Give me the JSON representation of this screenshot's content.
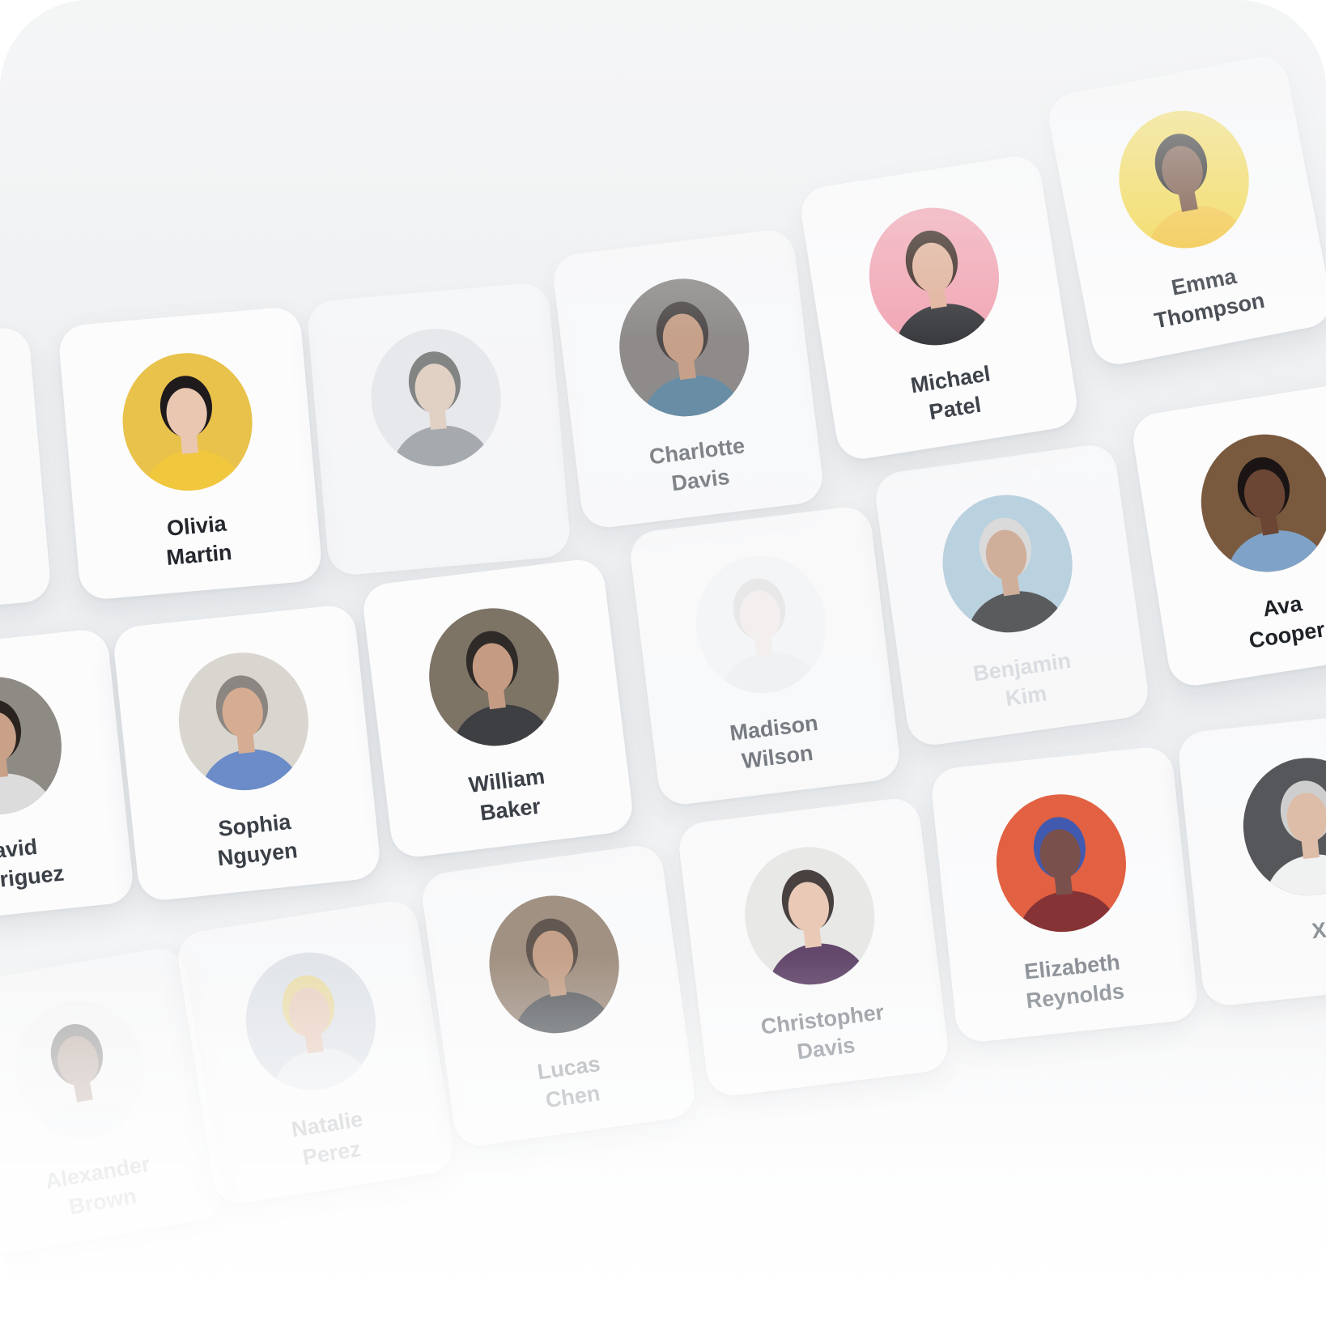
{
  "gallery": {
    "cards": [
      {
        "first": "Olivia",
        "last": "Martin",
        "tone": "#e8c24a",
        "skin": "#e9c7b1",
        "hair": "#1f1a1c",
        "shirt": "#f0c73d"
      },
      {
        "first": "",
        "last": "",
        "tone": "#dfe3e8",
        "skin": "#d7b8a2",
        "hair": "#2c2c2c",
        "shirt": "#6b7178"
      },
      {
        "first": "Charlotte",
        "last": "Davis",
        "tone": "#6e6a68",
        "skin": "#b98665",
        "hair": "#1a1413",
        "shirt": "#3c6d8c"
      },
      {
        "first": "Michael",
        "last": "Patel",
        "tone": "#f2a7b5",
        "skin": "#e1b39c",
        "hair": "#3b2a22",
        "shirt": "#3a3c40"
      },
      {
        "first": "Emma",
        "last": "Thompson",
        "tone": "#f4d84a",
        "skin": "#6b4532",
        "hair": "#161414",
        "shirt": "#f3c53b"
      },
      {
        "first": "David",
        "last": "Rodriguez",
        "tone": "#8e8a84",
        "skin": "#c9a189",
        "hair": "#2a2320",
        "shirt": "#dcdcdc"
      },
      {
        "first": "Sophia",
        "last": "Nguyen",
        "tone": "#d9d6cf",
        "skin": "#d6ad92",
        "hair": "#8b8682",
        "shirt": "#6b8cc9"
      },
      {
        "first": "William",
        "last": "Baker",
        "tone": "#7d7466",
        "skin": "#c59c83",
        "hair": "#2e2a28",
        "shirt": "#3d3f42"
      },
      {
        "first": "Madison",
        "last": "Wilson",
        "tone": "#eef0f2",
        "skin": "#eadfd8",
        "hair": "#c9c9c9",
        "shirt": "#e3e5e8"
      },
      {
        "first": "Benjamin",
        "last": "Kim",
        "tone": "#a9c7d9",
        "skin": "#c79a7d",
        "hair": "#d4d4d4",
        "shirt": "#2a2a2c"
      },
      {
        "first": "Ava",
        "last": "Cooper",
        "tone": "#7a5a3f",
        "skin": "#6b4634",
        "hair": "#1a1514",
        "shirt": "#7fa3c8"
      },
      {
        "first": "Alexander",
        "last": "Brown",
        "tone": "#f4f5f6",
        "skin": "#7a5440",
        "hair": "#1d1716",
        "shirt": "#eef0f4"
      },
      {
        "first": "Natalie",
        "last": "Perez",
        "tone": "#d8dde4",
        "skin": "#e6c1ad",
        "hair": "#e6d38a",
        "shirt": "#e9ecef"
      },
      {
        "first": "Lucas",
        "last": "Chen",
        "tone": "#8b7663",
        "skin": "#b98b6c",
        "hair": "#3a2d24",
        "shirt": "#3b3f44"
      },
      {
        "first": "Christopher",
        "last": "Davis",
        "tone": "#e7e7e4",
        "skin": "#e9c4ad",
        "hair": "#2b2320",
        "shirt": "#4b2b55"
      },
      {
        "first": "Elizabeth",
        "last": "Reynolds",
        "tone": "#e0522f",
        "skin": "#6e3f3a",
        "hair": "#2f4aa8",
        "shirt": "#7b1f22"
      },
      {
        "first": "X",
        "last": "",
        "tone": "#3b3d40",
        "skin": "#dcb59c",
        "hair": "#c9c9c9",
        "shirt": "#f1f1f1"
      }
    ]
  }
}
